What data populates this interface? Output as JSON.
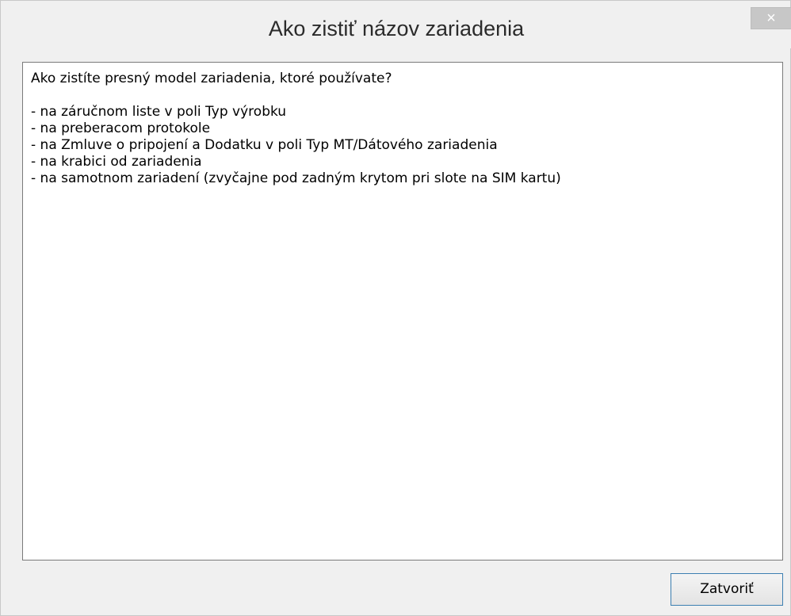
{
  "window": {
    "title": "Ako zistiť názov zariadenia",
    "close_icon": "×"
  },
  "content": {
    "question": "Ako zistíte presný model zariadenia, ktoré používate?",
    "items": [
      "- na záručnom liste v poli Typ výrobku",
      "- na preberacom protokole",
      "- na Zmluve o pripojení a Dodatku v poli Typ MT/Dátového zariadenia",
      "- na krabici od zariadenia",
      "- na samotnom zariadení (zvyčajne pod zadným krytom pri slote na SIM kartu)"
    ]
  },
  "footer": {
    "close_label": "Zatvoriť"
  },
  "colors": {
    "dialog_bg": "#f0f0f0",
    "accent_border": "#3c7fb1",
    "close_bg": "#c7c7c7"
  }
}
